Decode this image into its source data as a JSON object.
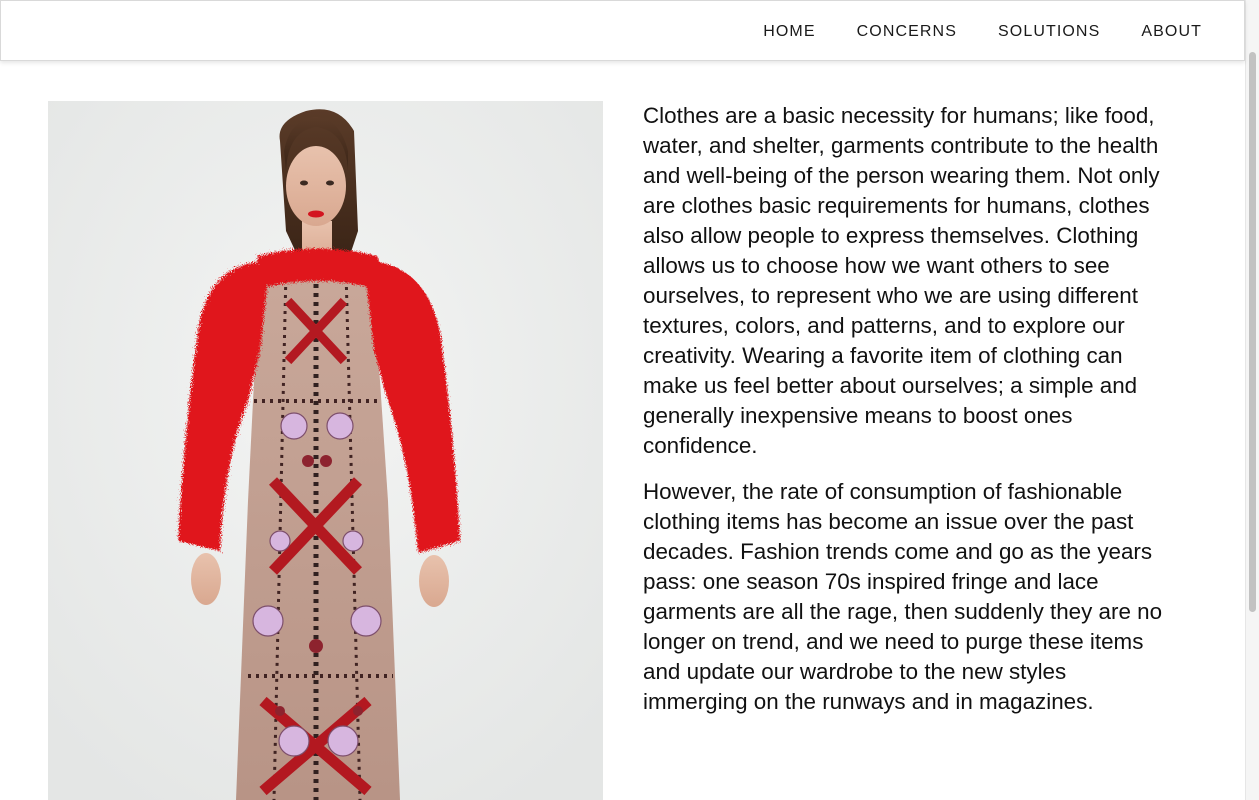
{
  "nav": {
    "items": [
      {
        "label": "HOME"
      },
      {
        "label": "CONCERNS"
      },
      {
        "label": "SOLUTIONS"
      },
      {
        "label": "ABOUT"
      }
    ]
  },
  "hero": {
    "image": "model-red-fur-jacket-embroidered-gown"
  },
  "article": {
    "paragraphs": [
      "Clothes are a basic necessity for humans; like food, water, and shelter, garments contribute to the health and well-being of the person wearing them. Not only are clothes basic requirements for humans, clothes also allow people to express themselves. Clothing allows us to choose how we want others to see ourselves, to represent who we are using different textures, colors, and patterns, and to explore our creativity. Wearing a favorite item of clothing can make us feel better about ourselves; a simple and generally inexpensive means to boost ones confidence.",
      "However, the rate of consumption of fashionable clothing items has become an issue over the past decades. Fashion trends come and go as the years pass: one season 70s inspired fringe and lace garments are all the rage, then suddenly they are no longer on trend, and we need to purge these items and update our wardrobe to the new styles immerging on the runways and in magazines."
    ]
  },
  "colors": {
    "jacket": "#e0161c",
    "text": "#111111",
    "nav_text": "#1a1a1a"
  }
}
